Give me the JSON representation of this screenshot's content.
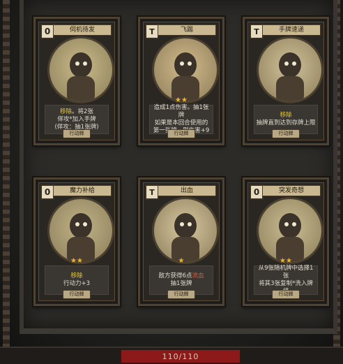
{
  "cards": [
    {
      "cost": "0",
      "name": "伺机待发",
      "lines": [
        {
          "text": "移除",
          "style": "kw",
          "suffix": "。将2张"
        },
        {
          "text": "佯攻*加入手牌"
        },
        {
          "text": "(佯攻：抽1张牌)"
        }
      ],
      "stars": "",
      "type": "行动牌",
      "art_color": "#c8bb8a"
    },
    {
      "cost": "T",
      "name": "飞踢",
      "lines": [
        {
          "text": "造成1点伤害。抽1张牌"
        },
        {
          "text": "如果是本回合使用的"
        },
        {
          "text": "第一张牌，则伤害+9"
        }
      ],
      "stars": "★★",
      "type": "行动牌",
      "art_color": "#d2b98c"
    },
    {
      "cost": "T",
      "name": "手牌速递",
      "lines": [
        {
          "text": "移除",
          "style": "kw"
        },
        {
          "text": "抽牌直到达到存牌上限"
        }
      ],
      "stars": "",
      "type": "行动牌",
      "art_color": "#cfc19a"
    },
    {
      "cost": "0",
      "name": "魔力补给",
      "lines": [
        {
          "text": "移除",
          "style": "kw"
        },
        {
          "text": "行动力+3"
        }
      ],
      "stars": "★★",
      "type": "行动牌",
      "art_color": "#bfb287"
    },
    {
      "cost": "T",
      "name": "出血",
      "lines": [
        {
          "text": "敌方获得6点",
          "suffix_kw": "流血"
        },
        {
          "text": "抽1张牌"
        }
      ],
      "stars": "★",
      "type": "行动牌",
      "art_color": "#d6c7a1"
    },
    {
      "cost": "0",
      "name": "突发奇想",
      "lines": [
        {
          "text": "从9张随机牌中选择1张"
        },
        {
          "text": "将其3张复制*洗入牌组"
        }
      ],
      "stars": "★★",
      "type": "行动牌",
      "art_color": "#c9bd93"
    }
  ],
  "hp": {
    "text": "110/110",
    "fraction": 1.0
  }
}
